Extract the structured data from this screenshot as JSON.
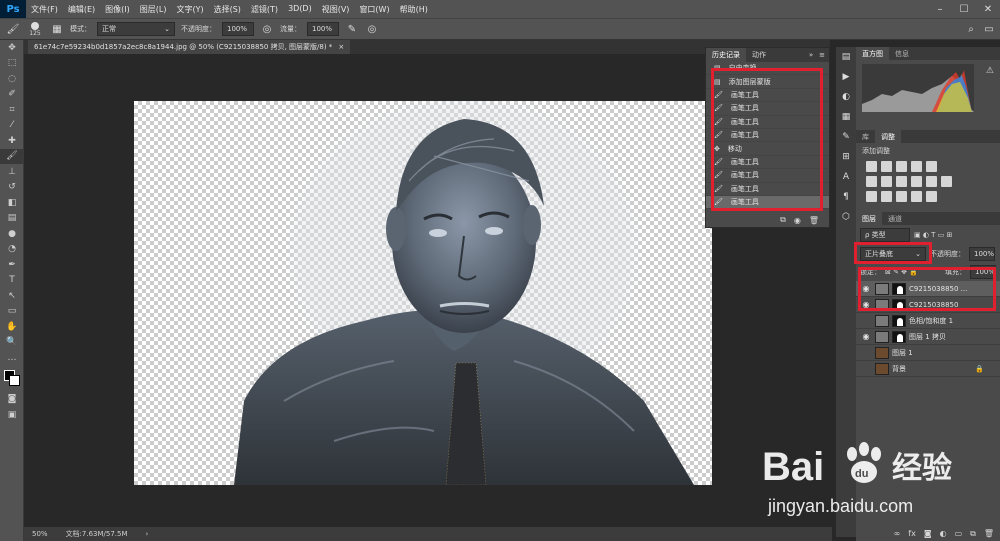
{
  "app": {
    "logo": "Ps"
  },
  "menu": [
    "文件(F)",
    "编辑(E)",
    "图像(I)",
    "图层(L)",
    "文字(Y)",
    "选择(S)",
    "滤镜(T)",
    "3D(D)",
    "视图(V)",
    "窗口(W)",
    "帮助(H)"
  ],
  "options": {
    "brush_size": "125",
    "mode_label": "模式：",
    "mode_value": "正常",
    "opacity_label": "不透明度：",
    "opacity_value": "100%",
    "flow_label": "流量：",
    "flow_value": "100%"
  },
  "document": {
    "tab_title": "61e74c7e59234b0d1857a2ec8c8a1944.jpg @ 50% (C9215038850 拷贝, 图层蒙版/8) *",
    "close": "×"
  },
  "status": {
    "zoom": "50%",
    "doc_info": "文档:7.63M/57.5M"
  },
  "history": {
    "tabs": [
      "历史记录",
      "动作"
    ],
    "items": [
      {
        "label": "自由变换",
        "icon": "doc-icon"
      },
      {
        "label": "添加图层蒙版",
        "icon": "doc-icon"
      },
      {
        "label": "画笔工具",
        "icon": "brush-icon"
      },
      {
        "label": "画笔工具",
        "icon": "brush-icon"
      },
      {
        "label": "画笔工具",
        "icon": "brush-icon"
      },
      {
        "label": "画笔工具",
        "icon": "brush-icon"
      },
      {
        "label": "移动",
        "icon": "move-icon"
      },
      {
        "label": "画笔工具",
        "icon": "brush-icon"
      },
      {
        "label": "画笔工具",
        "icon": "brush-icon"
      },
      {
        "label": "画笔工具",
        "icon": "brush-icon"
      },
      {
        "label": "画笔工具",
        "icon": "brush-icon"
      }
    ],
    "selected_index": 10
  },
  "histogram_panel": {
    "tabs": [
      "直方图",
      "信息"
    ]
  },
  "adjust_panel": {
    "tabs": [
      "库",
      "调整"
    ],
    "title": "添加调整"
  },
  "layers_panel": {
    "tabs": [
      "图层",
      "通道"
    ],
    "filter": "ρ 类型",
    "blend_mode": "正片叠底",
    "opacity_label": "不透明度：",
    "opacity_value": "100%",
    "lock_label": "锁定：",
    "fill_label": "填充：",
    "fill_value": "100%",
    "layers": [
      {
        "name": "C9215038850 ...",
        "visible": true
      },
      {
        "name": "C9215038850",
        "visible": true
      },
      {
        "name": "色相/饱和度 1",
        "visible": false
      },
      {
        "name": "图层 1 拷贝",
        "visible": true
      },
      {
        "name": "图层 1",
        "visible": false
      },
      {
        "name": "背景",
        "visible": false
      }
    ]
  },
  "watermark": {
    "brand": "Bai",
    "du": "du",
    "cn": "经验",
    "url": "jingyan.baidu.com"
  },
  "colors": {
    "highlight_box": "#e0202e",
    "panel_bg": "#4a4a4a",
    "canvas_bg": "#282828"
  }
}
